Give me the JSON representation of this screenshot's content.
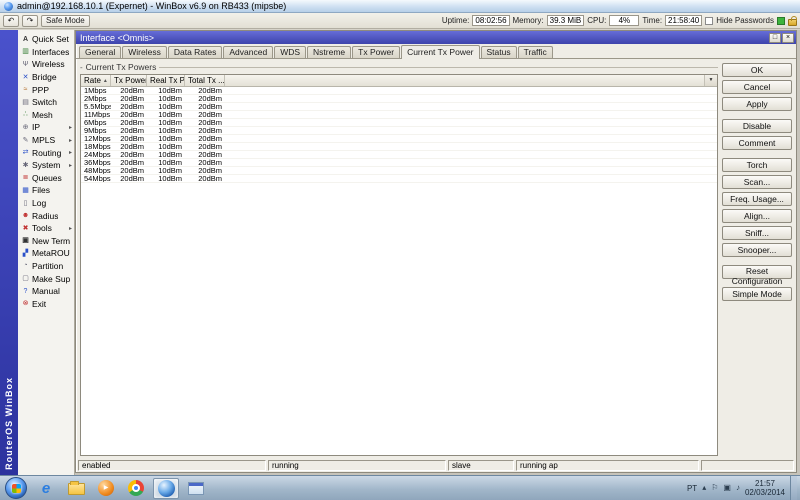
{
  "colors": {
    "child_titlebar_blue": "#4b52c4",
    "brand_strip_blue": "#3a41bc",
    "status_led_green": "#3db43d",
    "taskbar_silver": "#a2b7ca"
  },
  "app_titlebar": {
    "title": "admin@192.168.10.1 (Expernet) - WinBox v6.9 on RB433 (mipsbe)"
  },
  "toolbar": {
    "undo_glyph": "↶",
    "redo_glyph": "↷",
    "safe_mode": "Safe Mode",
    "stats": [
      {
        "label": "Uptime:",
        "value": "08:02:56"
      },
      {
        "label": "Memory:",
        "value": "39.3 MiB"
      },
      {
        "label": "CPU:",
        "value": "4%"
      },
      {
        "label": "Time:",
        "value": "21:58:40"
      }
    ],
    "hide_passwords": "Hide Passwords"
  },
  "sidebar": {
    "brand": "RouterOS WinBox",
    "items": [
      {
        "icon": "quick-set-icon",
        "glyph": "A",
        "label": "Quick Set",
        "arrow": ""
      },
      {
        "icon": "interfaces-icon",
        "glyph": "▥",
        "label": "Interfaces",
        "arrow": ""
      },
      {
        "icon": "wireless-icon",
        "glyph": "Ψ",
        "label": "Wireless",
        "arrow": ""
      },
      {
        "icon": "bridge-icon",
        "glyph": "✕",
        "label": "Bridge",
        "arrow": ""
      },
      {
        "icon": "ppp-icon",
        "glyph": "≈",
        "label": "PPP",
        "arrow": ""
      },
      {
        "icon": "switch-icon",
        "glyph": "▤",
        "label": "Switch",
        "arrow": ""
      },
      {
        "icon": "mesh-icon",
        "glyph": "∴",
        "label": "Mesh",
        "arrow": ""
      },
      {
        "icon": "ip-icon",
        "glyph": "⊕",
        "label": "IP",
        "arrow": "▸"
      },
      {
        "icon": "mpls-icon",
        "glyph": "✎",
        "label": "MPLS",
        "arrow": "▸"
      },
      {
        "icon": "routing-icon",
        "glyph": "⇄",
        "label": "Routing",
        "arrow": "▸"
      },
      {
        "icon": "system-icon",
        "glyph": "✱",
        "label": "System",
        "arrow": "▸"
      },
      {
        "icon": "queues-icon",
        "glyph": "≣",
        "label": "Queues",
        "arrow": ""
      },
      {
        "icon": "files-icon",
        "glyph": "▦",
        "label": "Files",
        "arrow": ""
      },
      {
        "icon": "log-icon",
        "glyph": "▯",
        "label": "Log",
        "arrow": ""
      },
      {
        "icon": "radius-icon",
        "glyph": "☻",
        "label": "Radius",
        "arrow": ""
      },
      {
        "icon": "tools-icon",
        "glyph": "✖",
        "label": "Tools",
        "arrow": "▸"
      },
      {
        "icon": "new-terminal-icon",
        "glyph": "▣",
        "label": "New Terminal",
        "arrow": ""
      },
      {
        "icon": "metarouter-icon",
        "glyph": "▞",
        "label": "MetaROUTER",
        "arrow": ""
      },
      {
        "icon": "partition-icon",
        "glyph": "◔",
        "label": "Partition",
        "arrow": ""
      },
      {
        "icon": "make-supout-icon",
        "glyph": "▢",
        "label": "Make Supout.rif",
        "arrow": ""
      },
      {
        "icon": "manual-icon",
        "glyph": "?",
        "label": "Manual",
        "arrow": ""
      },
      {
        "icon": "exit-icon",
        "glyph": "⊗",
        "label": "Exit",
        "arrow": ""
      }
    ]
  },
  "window": {
    "title": "Interface <Omnis>",
    "controls": {
      "restore_glyph": "□",
      "close_glyph": "×"
    },
    "tabs": [
      "General",
      "Wireless",
      "Data Rates",
      "Advanced",
      "WDS",
      "Nstreme",
      "Tx Power",
      "Current Tx Power",
      "Status",
      "Traffic"
    ],
    "active_tab": "Current Tx Power",
    "groupbox_title": "Current Tx Powers",
    "table": {
      "sort_glyph": "▲",
      "dropdown_glyph": "▼",
      "columns": [
        "Rate",
        "Tx Power",
        "Real Tx P...",
        "Total Tx ..."
      ],
      "rows": [
        [
          "1Mbps",
          "20dBm",
          "10dBm",
          "20dBm"
        ],
        [
          "2Mbps",
          "20dBm",
          "10dBm",
          "20dBm"
        ],
        [
          "5.5Mbps",
          "20dBm",
          "10dBm",
          "20dBm"
        ],
        [
          "11Mbps",
          "20dBm",
          "10dBm",
          "20dBm"
        ],
        [
          "6Mbps",
          "20dBm",
          "10dBm",
          "20dBm"
        ],
        [
          "9Mbps",
          "20dBm",
          "10dBm",
          "20dBm"
        ],
        [
          "12Mbps",
          "20dBm",
          "10dBm",
          "20dBm"
        ],
        [
          "18Mbps",
          "20dBm",
          "10dBm",
          "20dBm"
        ],
        [
          "24Mbps",
          "20dBm",
          "10dBm",
          "20dBm"
        ],
        [
          "36Mbps",
          "20dBm",
          "10dBm",
          "20dBm"
        ],
        [
          "48Mbps",
          "20dBm",
          "10dBm",
          "20dBm"
        ],
        [
          "54Mbps",
          "20dBm",
          "10dBm",
          "20dBm"
        ]
      ]
    },
    "buttons": [
      "OK",
      "Cancel",
      "Apply",
      "Disable",
      "Comment",
      "Torch",
      "Scan...",
      "Freq. Usage...",
      "Align...",
      "Sniff...",
      "Snooper...",
      "Reset Configuration",
      "Simple Mode"
    ],
    "status_cells": [
      "enabled",
      "running",
      "slave",
      "running ap",
      ""
    ]
  },
  "taskbar": {
    "icons": [
      "start-button",
      "internet-explorer-icon",
      "windows-explorer-icon",
      "media-player-icon",
      "chrome-icon",
      "winbox-globe-icon",
      "winbox-app-icon"
    ],
    "active_icon": "winbox-globe-icon",
    "media_play_glyph": "▶",
    "tray": {
      "language": "PT",
      "icons": [
        {
          "name": "hidden-icons-chevron",
          "glyph": "▴"
        },
        {
          "name": "flag-icon",
          "glyph": "⚐"
        },
        {
          "name": "network-icon",
          "glyph": "▣"
        },
        {
          "name": "volume-icon",
          "glyph": "♪"
        }
      ],
      "time": "21:57",
      "date": "02/03/2014"
    }
  }
}
